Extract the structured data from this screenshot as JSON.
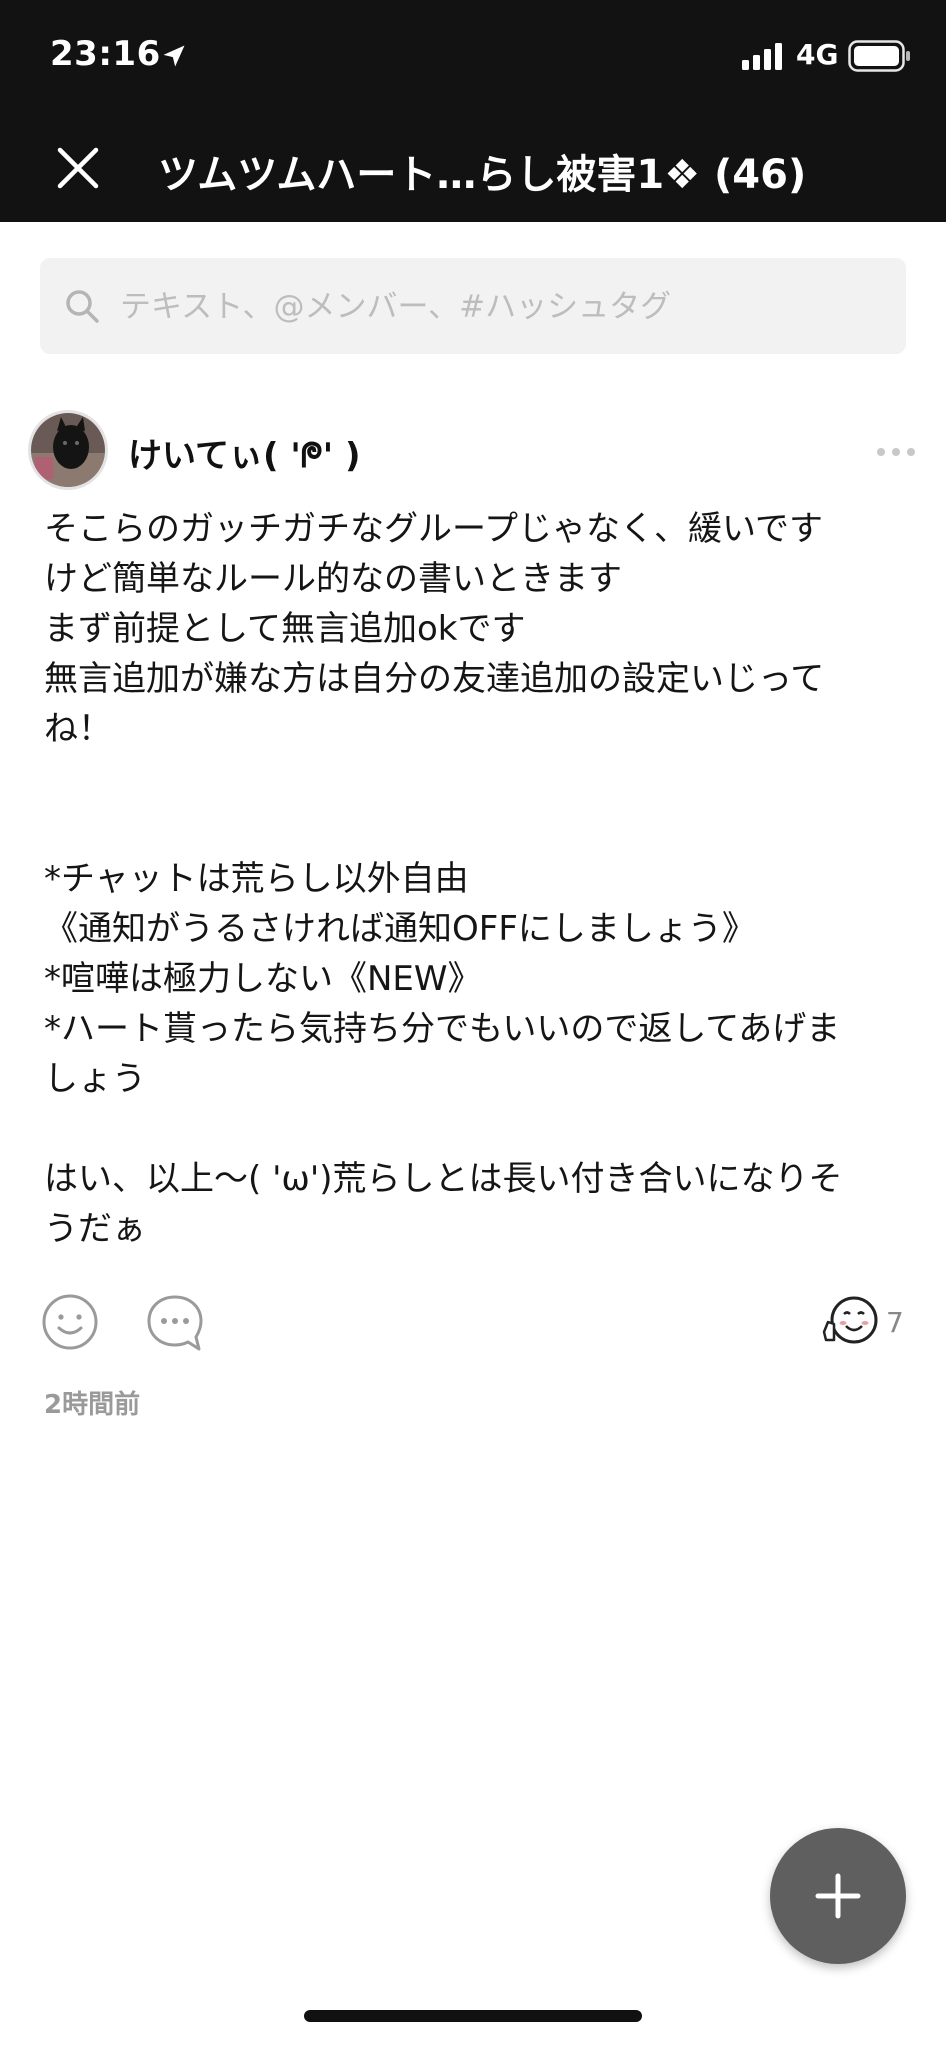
{
  "status_bar": {
    "time": "23:16",
    "network": "4G",
    "icons": [
      "location-arrow-icon",
      "signal-icon",
      "battery-icon"
    ]
  },
  "header": {
    "title": "ツムツムハート…らし被害1❖ (46)",
    "close_icon": "close-icon"
  },
  "search": {
    "placeholder": "テキスト、@メンバー、#ハッシュタグ",
    "value": ""
  },
  "post": {
    "author": "けいてぃ( 'ᖘ' )",
    "body": "そこらのガッチガチなグループじゃなく、緩いです\nけど簡単なルール的なの書いときます\nまず前提として無言追加okです\n無言追加が嫌な方は自分の友達追加の設定いじって\nね！\n\n\n*チャットは荒らし以外自由\n《通知がうるさければ通知OFFにしましょう》\n*喧嘩は極力しない《NEW》\n*ハート貰ったら気持ち分でもいいので返してあげま\nしょう\n\nはい、以上〜( 'ω')荒らしとは長い付き合いになりそ\nうだぁ",
    "reaction_count": "7",
    "timestamp": "2時間前"
  },
  "colors": {
    "header_bg": "#121212",
    "search_bg": "#f2f2f2",
    "fab_bg": "#5f5f5f"
  }
}
